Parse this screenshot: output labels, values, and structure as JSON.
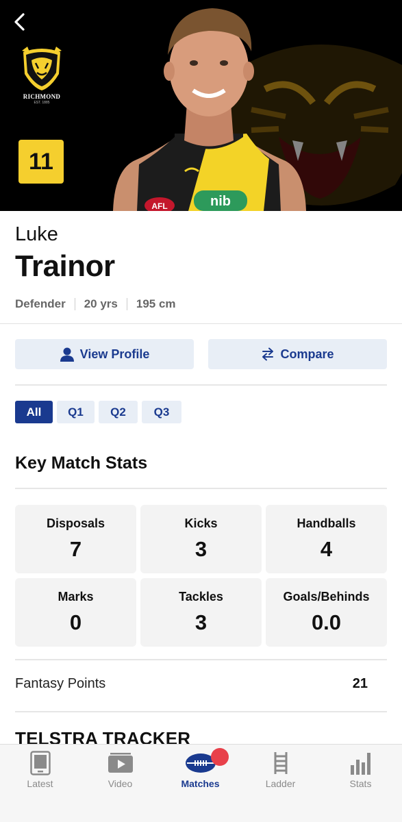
{
  "header": {
    "back_label": "back",
    "club_name": "RICHMOND",
    "club_est": "EST. 1885",
    "jersey_number": "11",
    "sponsor": "nib",
    "league_badge": "AFL"
  },
  "player": {
    "first_name": "Luke",
    "last_name": "Trainor",
    "position": "Defender",
    "age": "20 yrs",
    "height": "195 cm"
  },
  "actions": {
    "view_profile": "View Profile",
    "compare": "Compare"
  },
  "quarter_tabs": [
    {
      "label": "All",
      "active": true
    },
    {
      "label": "Q1",
      "active": false
    },
    {
      "label": "Q2",
      "active": false
    },
    {
      "label": "Q3",
      "active": false
    }
  ],
  "key_stats": {
    "title": "Key Match Stats",
    "items": [
      {
        "label": "Disposals",
        "value": "7"
      },
      {
        "label": "Kicks",
        "value": "3"
      },
      {
        "label": "Handballs",
        "value": "4"
      },
      {
        "label": "Marks",
        "value": "0"
      },
      {
        "label": "Tackles",
        "value": "3"
      },
      {
        "label": "Goals/Behinds",
        "value": "0.0"
      }
    ]
  },
  "fantasy": {
    "label": "Fantasy Points",
    "value": "21"
  },
  "tracker": {
    "title": "TELSTRA TRACKER"
  },
  "bottom_nav": {
    "items": [
      {
        "label": "Latest",
        "icon": "tablet-icon",
        "active": false
      },
      {
        "label": "Video",
        "icon": "play-icon",
        "active": false
      },
      {
        "label": "Matches",
        "icon": "football-icon",
        "active": true,
        "has_notification": true
      },
      {
        "label": "Ladder",
        "icon": "ladder-icon",
        "active": false
      },
      {
        "label": "Stats",
        "icon": "bar-chart-icon",
        "active": false
      }
    ]
  },
  "colors": {
    "accent": "#1a3a8f",
    "badge_yellow": "#f5cf2e",
    "notification": "#e8404a",
    "card_bg": "#f3f3f3"
  }
}
